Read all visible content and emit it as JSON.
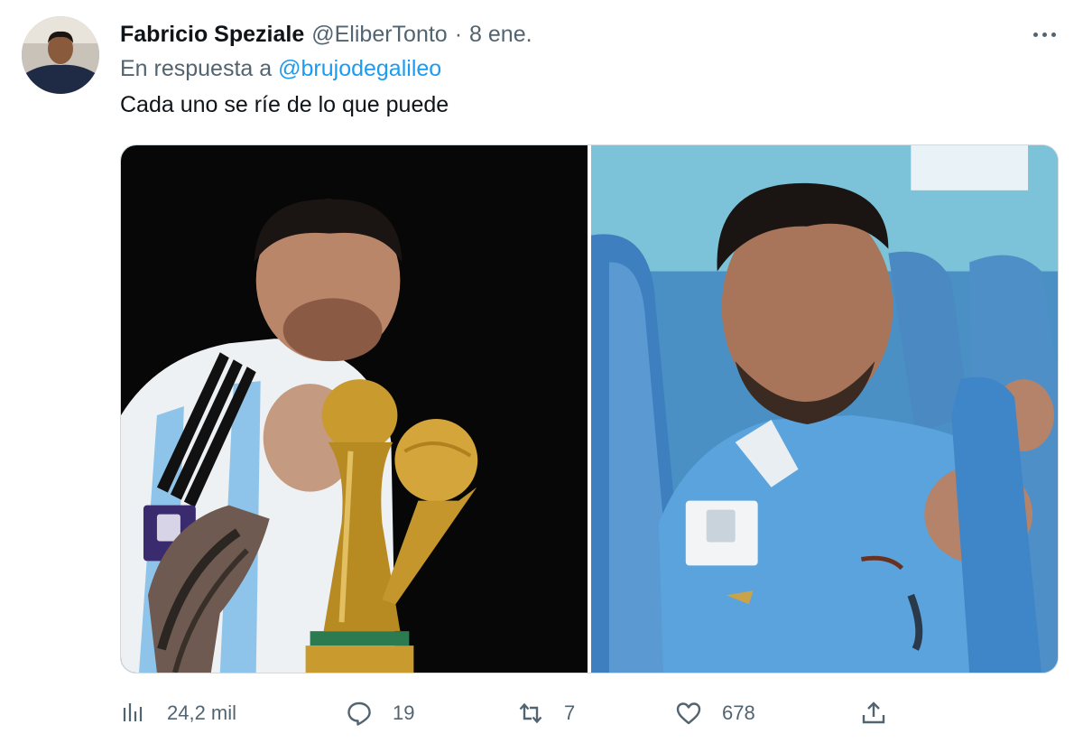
{
  "author": {
    "display_name": "Fabricio Speziale",
    "handle": "@EliberTonto",
    "separator": "·",
    "time": "8 ene."
  },
  "reply": {
    "prefix": "En respuesta a",
    "to": "@brujodegalileo"
  },
  "text": "Cada uno se ríe de lo que puede",
  "metrics": {
    "views": "24,2 mil",
    "replies": "19",
    "retweets": "7",
    "likes": "678"
  },
  "icons": {
    "more": "more-horizontal-icon",
    "views": "bar-chart-icon",
    "reply": "speech-bubble-icon",
    "retweet": "retweet-arrows-icon",
    "like": "heart-icon",
    "share": "share-upload-icon"
  },
  "colors": {
    "accent": "#1d9bf0",
    "text": "#0f1419",
    "muted": "#536471",
    "border": "#cfd9de"
  }
}
